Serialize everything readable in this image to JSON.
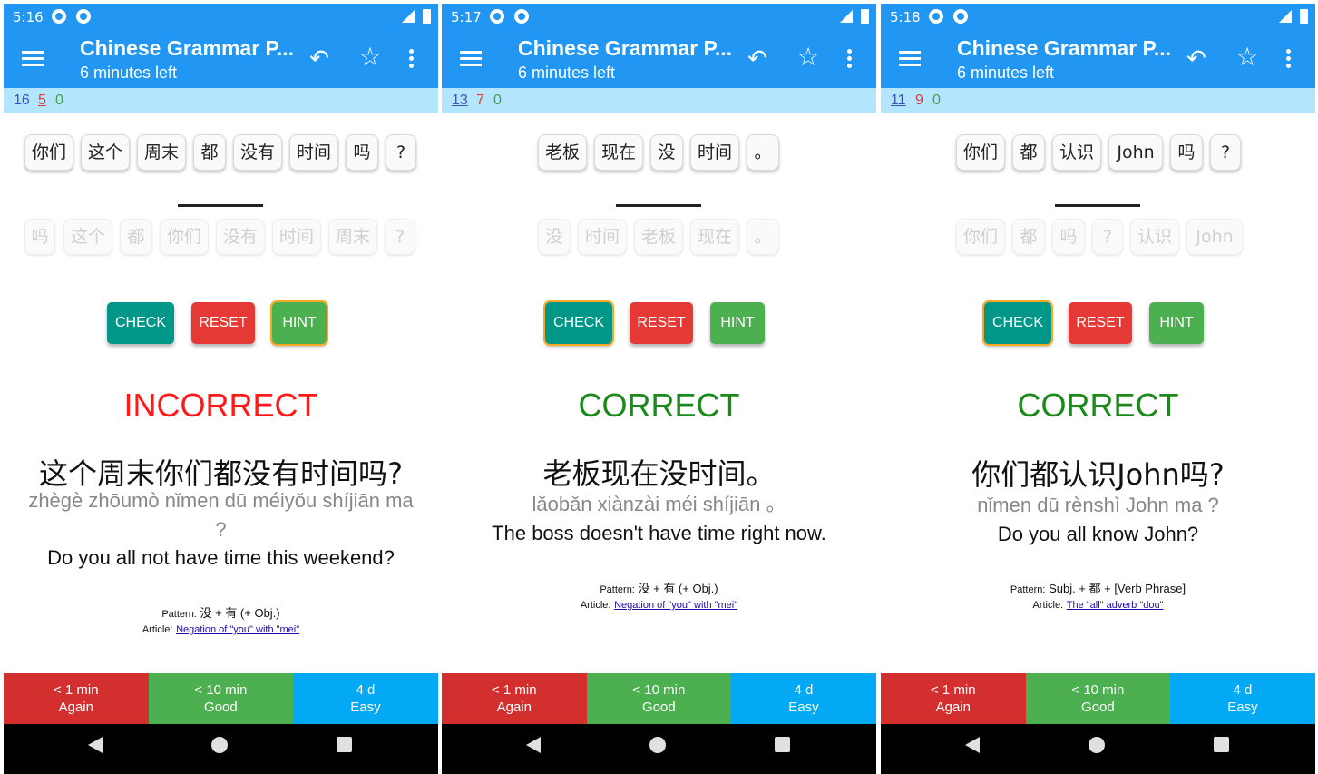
{
  "common": {
    "app_title": "Chinese Grammar P...",
    "subtitle": "6 minutes left",
    "buttons": {
      "check": "CHECK",
      "reset": "RESET",
      "hint": "HINT"
    },
    "pattern_label": "Pattern:",
    "article_label": "Article:",
    "answers": {
      "again": {
        "interval": "< 1 min",
        "label": "Again"
      },
      "good": {
        "interval": "< 10 min",
        "label": "Good"
      },
      "easy": {
        "interval": "4 d",
        "label": "Easy"
      }
    },
    "colors": {
      "app_bar": "#2196f3",
      "count_bar": "#b3e5fc",
      "check": "#009688",
      "reset": "#e53935",
      "hint": "#4caf50",
      "incorrect": "#ff1a1a",
      "correct": "#1b8a1b",
      "again": "#d32f2f",
      "good": "#4caf50",
      "easy": "#03a9f4"
    },
    "icons": [
      "menu-icon",
      "undo-icon",
      "star-icon",
      "more-vert-icon",
      "signal-icon",
      "battery-icon",
      "back-nav-icon",
      "home-nav-icon",
      "recents-nav-icon"
    ]
  },
  "panels": [
    {
      "time": "5:16",
      "counts": {
        "new": "16",
        "learning": "5",
        "review": "0"
      },
      "top_tiles": [
        "你们",
        "这个",
        "周末",
        "都",
        "没有",
        "时间",
        "吗",
        "?"
      ],
      "bottom_tiles": [
        "吗",
        "这个",
        "都",
        "你们",
        "没有",
        "时间",
        "周末",
        "?"
      ],
      "result": "INCORRECT",
      "sentence": "这个周末你们都没有时间吗?",
      "pinyin": "zhègè zhōumò nǐmen dū méiyǒu shíjiān ma ?",
      "english": "Do you all not have time this weekend?",
      "pattern": "没 + 有 (+ Obj.)",
      "article": "Negation of \"you\" with \"mei\""
    },
    {
      "time": "5:17",
      "counts": {
        "new": "13",
        "learning": "7",
        "review": "0"
      },
      "top_tiles": [
        "老板",
        "现在",
        "没",
        "时间",
        "。"
      ],
      "bottom_tiles": [
        "没",
        "时间",
        "老板",
        "现在",
        "。"
      ],
      "result": "CORRECT",
      "sentence": "老板现在没时间。",
      "pinyin": "lǎobǎn xiànzài méi shíjiān 。",
      "english": "The boss doesn't have time right now.",
      "pattern": "没 + 有 (+ Obj.)",
      "article": "Negation of \"you\" with \"mei\""
    },
    {
      "time": "5:18",
      "counts": {
        "new": "11",
        "learning": "9",
        "review": "0"
      },
      "top_tiles": [
        "你们",
        "都",
        "认识",
        "John",
        "吗",
        "?"
      ],
      "bottom_tiles": [
        "你们",
        "都",
        "吗",
        "?",
        "认识",
        "John"
      ],
      "result": "CORRECT",
      "sentence": "你们都认识John吗?",
      "pinyin": "nǐmen dū rènshì John ma ?",
      "english": "Do you all know John?",
      "pattern": "Subj. + 都 + [Verb Phrase]",
      "article": "The \"all\" adverb \"dou\""
    }
  ]
}
